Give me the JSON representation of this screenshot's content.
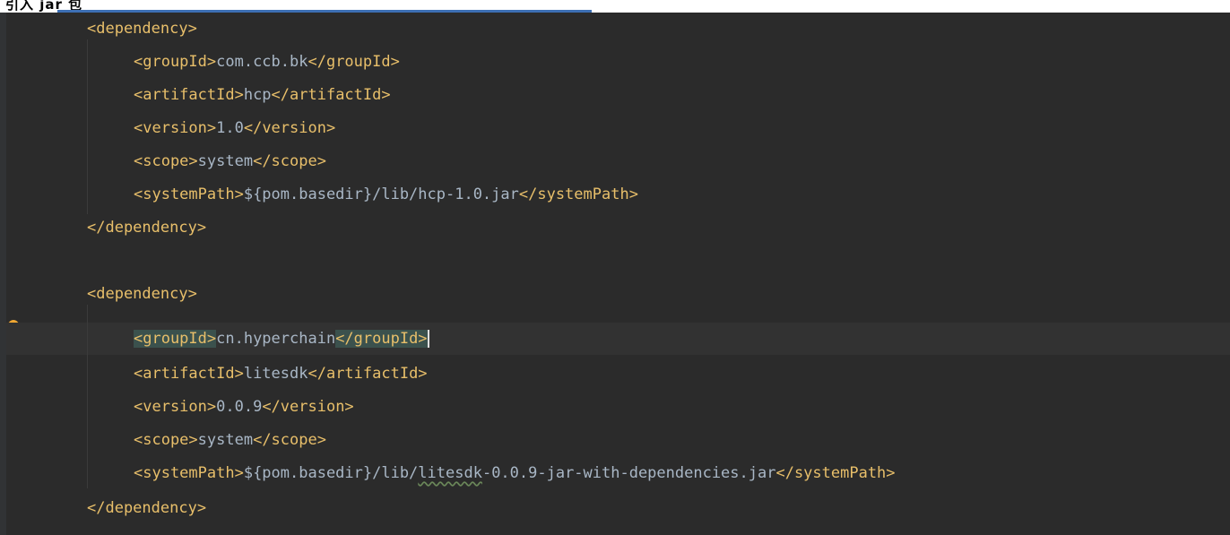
{
  "top_strip": {
    "text": "引入 jar 包"
  },
  "lines": [
    {
      "parts": [
        {
          "t": "<dependency>",
          "k": "tag"
        }
      ]
    },
    {
      "parts": [
        {
          "t": "<groupId>",
          "k": "tag"
        },
        {
          "t": "com.ccb.bk",
          "k": "txt"
        },
        {
          "t": "</groupId>",
          "k": "tag"
        }
      ]
    },
    {
      "parts": [
        {
          "t": "<artifactId>",
          "k": "tag"
        },
        {
          "t": "hcp",
          "k": "txt"
        },
        {
          "t": "</artifactId>",
          "k": "tag"
        }
      ]
    },
    {
      "parts": [
        {
          "t": "<version>",
          "k": "tag"
        },
        {
          "t": "1.0",
          "k": "txt"
        },
        {
          "t": "</version>",
          "k": "tag"
        }
      ]
    },
    {
      "parts": [
        {
          "t": "<scope>",
          "k": "tag"
        },
        {
          "t": "system",
          "k": "txt"
        },
        {
          "t": "</scope>",
          "k": "tag"
        }
      ]
    },
    {
      "parts": [
        {
          "t": "<systemPath>",
          "k": "tag"
        },
        {
          "t": "${pom.basedir}/lib/hcp-1.0.jar",
          "k": "txt"
        },
        {
          "t": "</systemPath>",
          "k": "tag"
        }
      ]
    },
    {
      "parts": [
        {
          "t": "</dependency>",
          "k": "tag"
        }
      ]
    },
    {
      "parts": []
    },
    {
      "parts": [
        {
          "t": "<dependency>",
          "k": "tag"
        }
      ]
    },
    {
      "parts": [
        {
          "t": "<groupId>",
          "k": "tag",
          "hl": true
        },
        {
          "t": "cn.hyperchain",
          "k": "txt"
        },
        {
          "t": "</groupId>",
          "k": "tag",
          "hl": true
        }
      ]
    },
    {
      "parts": [
        {
          "t": "<artifactId>",
          "k": "tag"
        },
        {
          "t": "litesdk",
          "k": "txt"
        },
        {
          "t": "</artifactId>",
          "k": "tag"
        }
      ]
    },
    {
      "parts": [
        {
          "t": "<version>",
          "k": "tag"
        },
        {
          "t": "0.0.9",
          "k": "txt"
        },
        {
          "t": "</version>",
          "k": "tag"
        }
      ]
    },
    {
      "parts": [
        {
          "t": "<scope>",
          "k": "tag"
        },
        {
          "t": "system",
          "k": "txt"
        },
        {
          "t": "</scope>",
          "k": "tag"
        }
      ]
    },
    {
      "parts": [
        {
          "t": "<systemPath>",
          "k": "tag"
        },
        {
          "t": "${pom.basedir}/lib/",
          "k": "txt"
        },
        {
          "t": "litesdk",
          "k": "txt",
          "typo": true
        },
        {
          "t": "-0.0.9-jar-with-dependencies.jar",
          "k": "txt"
        },
        {
          "t": "</systemPath>",
          "k": "tag"
        }
      ]
    },
    {
      "parts": [
        {
          "t": "</dependency>",
          "k": "tag"
        }
      ]
    }
  ],
  "colors": {
    "background": "#2b2b2b",
    "tag": "#e8bf6a",
    "text": "#a9b7c6",
    "match_highlight": "#3b514d",
    "current_line": "#323232"
  },
  "icons": {
    "intention_bulb": "lightbulb-icon"
  }
}
